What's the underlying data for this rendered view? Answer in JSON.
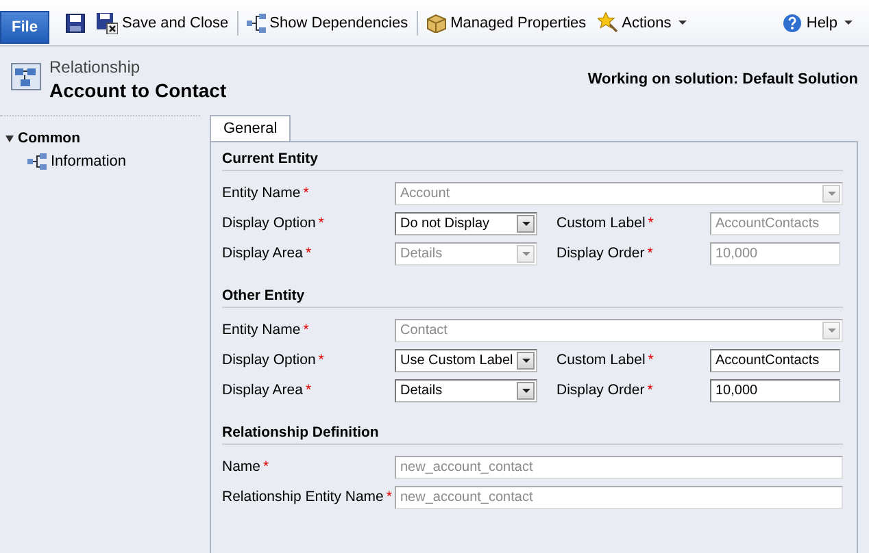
{
  "toolbar": {
    "file_button": "File",
    "items": [
      {
        "kind": "save"
      },
      {
        "kind": "save-close",
        "label": "Save and Close"
      },
      {
        "kind": "divider"
      },
      {
        "kind": "dependencies",
        "label": "Show Dependencies"
      },
      {
        "kind": "divider"
      },
      {
        "kind": "managed",
        "label": "Managed Properties"
      },
      {
        "kind": "actions",
        "label": "Actions"
      }
    ],
    "help": "Help"
  },
  "header": {
    "entity_type": "Relationship",
    "title": "Account to Contact",
    "solution": "Working on solution: Default Solution"
  },
  "sidebar": {
    "group": "Common",
    "expanded": true,
    "items": [
      {
        "label": "Information",
        "selected": false
      }
    ]
  },
  "tabs": [
    {
      "label": "General",
      "selected": true
    }
  ],
  "sections": [
    {
      "title": "Current Entity",
      "rows": [
        {
          "kind": "wide",
          "fields": [
            {
              "label": "Entity Name",
              "required_mark": "*",
              "kind": "select",
              "value": "Account",
              "disabled": true
            }
          ]
        },
        {
          "kind": "pair",
          "fields": [
            {
              "label": "Display Option",
              "required_mark": "*",
              "kind": "select",
              "value": "Do not Display",
              "disabled": false
            },
            {
              "label": "Custom Label",
              "required_mark": "*",
              "kind": "text",
              "value": "AccountContacts",
              "disabled": true
            }
          ]
        },
        {
          "kind": "pair",
          "fields": [
            {
              "label": "Display Area",
              "required_mark": "*",
              "kind": "select",
              "value": "Details",
              "disabled": true
            },
            {
              "label": "Display Order",
              "required_mark": "*",
              "kind": "text",
              "value": "10,000",
              "disabled": true
            }
          ]
        }
      ]
    },
    {
      "title": "Other Entity",
      "rows": [
        {
          "kind": "wide",
          "fields": [
            {
              "label": "Entity Name",
              "required_mark": "*",
              "kind": "select",
              "value": "Contact",
              "disabled": true
            }
          ]
        },
        {
          "kind": "pair",
          "fields": [
            {
              "label": "Display Option",
              "required_mark": "*",
              "kind": "select",
              "value": "Use Custom Label",
              "disabled": false
            },
            {
              "label": "Custom Label",
              "required_mark": "*",
              "kind": "text",
              "value": "AccountContacts",
              "disabled": false
            }
          ]
        },
        {
          "kind": "pair",
          "fields": [
            {
              "label": "Display Area",
              "required_mark": "*",
              "kind": "select",
              "value": "Details",
              "disabled": false
            },
            {
              "label": "Display Order",
              "required_mark": "*",
              "kind": "text",
              "value": "10,000",
              "disabled": false
            }
          ]
        }
      ]
    },
    {
      "title": "Relationship Definition",
      "rows": [
        {
          "kind": "wide",
          "fields": [
            {
              "label": "Name",
              "required_mark": "*",
              "kind": "text",
              "value": "new_account_contact",
              "disabled": true
            }
          ]
        },
        {
          "kind": "wide",
          "fields": [
            {
              "label": "Relationship Entity Name",
              "required_mark": "*",
              "kind": "text",
              "value": "new_account_contact",
              "disabled": true
            }
          ]
        }
      ]
    }
  ]
}
